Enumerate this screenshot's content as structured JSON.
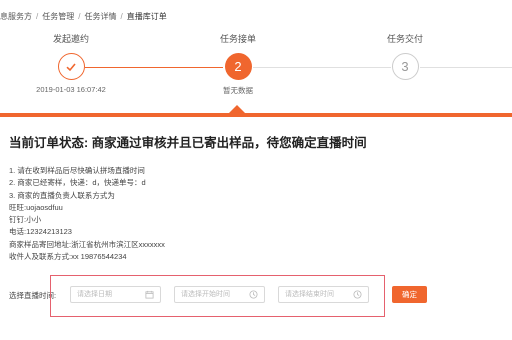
{
  "breadcrumb": {
    "items": [
      "息服务方",
      "任务管理",
      "任务详情",
      "直播库订单"
    ],
    "separator": "/"
  },
  "steps": [
    {
      "title": "发起邀约",
      "sub": "2019-01-03 16:07:42",
      "state": "done"
    },
    {
      "title": "任务接单",
      "number": "2",
      "sub": "暂无数据",
      "state": "active"
    },
    {
      "title": "任务交付",
      "number": "3",
      "sub": "",
      "state": "pending"
    }
  ],
  "colors": {
    "accent": "#f0662e",
    "done_line": "#f0662e",
    "pending_line": "#e0e0e0",
    "highlight": "#e5616e"
  },
  "status": {
    "title": "当前订单状态: 商家通过审核并且已寄出样品，待您确定直播时间"
  },
  "details": {
    "lines": [
      "1. 请在收到样品后尽快确认拼场直播时间",
      "2. 商家已经寄样，快递：d，快递单号：d",
      "3. 商家的直播负责人联系方式为",
      "旺旺:uojaosdfuu",
      "钉钉:小小",
      "电话:12324213123",
      "商家样品寄回地址:浙江省杭州市滨江区xxxxxxx",
      "收件人及联系方式:xx 19876544234"
    ]
  },
  "schedule": {
    "label": "选择直播时间:",
    "date_placeholder": "请选择日期",
    "start_placeholder": "请选择开始时间",
    "end_placeholder": "请选择结束时间",
    "date_icon": "calendar-icon",
    "time_icon": "clock-icon",
    "confirm_label": "确定"
  }
}
